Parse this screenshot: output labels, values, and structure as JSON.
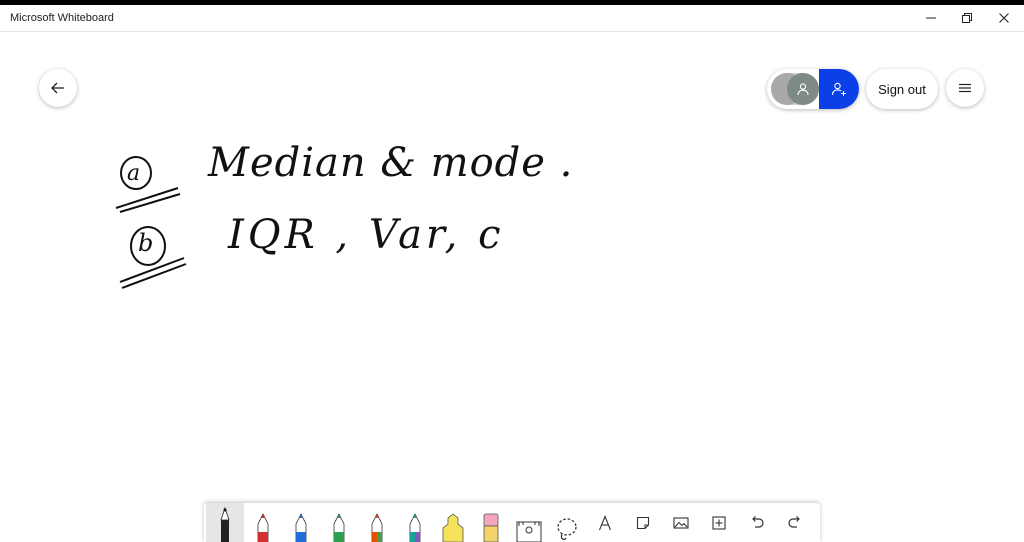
{
  "window": {
    "title": "Microsoft Whiteboard"
  },
  "header": {
    "sign_out_label": "Sign out"
  },
  "board": {
    "items": [
      {
        "marker": "a",
        "text": "Median & mode ."
      },
      {
        "marker": "b",
        "text": "IQR , Var, c"
      }
    ]
  },
  "toolbar": {
    "tools": [
      {
        "name": "pen-black",
        "color": "#111111"
      },
      {
        "name": "pen-red",
        "color": "#d32f2f"
      },
      {
        "name": "pen-blue",
        "color": "#1e6fd9"
      },
      {
        "name": "pen-green",
        "color": "#2e9e4f"
      },
      {
        "name": "pen-rainbow",
        "color": "#e65100"
      },
      {
        "name": "pen-galaxy",
        "color": "#1aa39a"
      },
      {
        "name": "highlighter",
        "color": "#f7e35a"
      },
      {
        "name": "eraser",
        "color": "#f4a6c0"
      },
      {
        "name": "ruler-icon"
      },
      {
        "name": "lasso-icon"
      },
      {
        "name": "text-icon"
      },
      {
        "name": "sticky-note-icon"
      },
      {
        "name": "image-icon"
      },
      {
        "name": "add-icon"
      },
      {
        "name": "undo-icon"
      },
      {
        "name": "redo-icon"
      }
    ]
  },
  "colors": {
    "accent": "#0b3fe8"
  }
}
